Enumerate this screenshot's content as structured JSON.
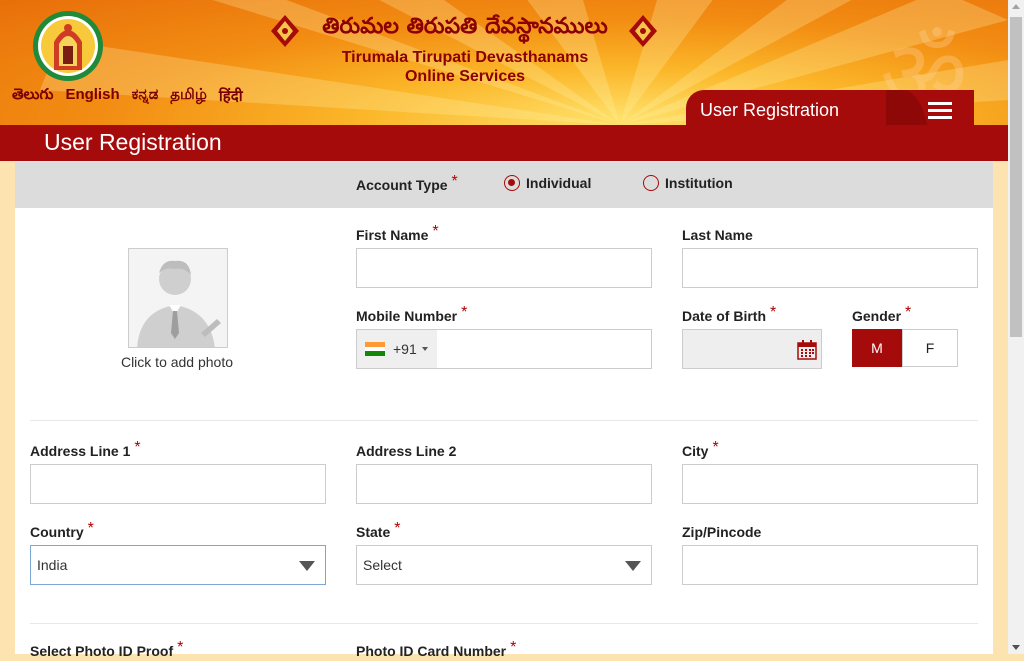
{
  "header": {
    "title_telugu": "తిరుమల తిరుపతి దేవస్థానములు",
    "title_english": "Tirumala Tirupati Devasthanams",
    "subtitle": "Online Services",
    "om_symbol": "ॐ",
    "languages": [
      "తెలుగు",
      "English",
      "ಕನ್ನಡ",
      "தமிழ்",
      "हिंदी"
    ],
    "page_tab_label": "User Registration"
  },
  "page": {
    "title": "User Registration"
  },
  "form": {
    "account_type": {
      "label": "Account Type",
      "required": "*",
      "options": [
        "Individual",
        "Institution"
      ],
      "selected": "Individual"
    },
    "photo_caption": "Click to add photo",
    "first_name": {
      "label": "First Name",
      "required": "*",
      "value": ""
    },
    "last_name": {
      "label": "Last Name",
      "value": ""
    },
    "mobile": {
      "label": "Mobile Number",
      "required": "*",
      "country_code": "+91",
      "value": ""
    },
    "dob": {
      "label": "Date of Birth",
      "required": "*",
      "value": ""
    },
    "gender": {
      "label": "Gender",
      "required": "*",
      "options": [
        "M",
        "F"
      ],
      "selected": "M"
    },
    "address1": {
      "label": "Address Line 1",
      "required": "*",
      "value": ""
    },
    "address2": {
      "label": "Address Line 2",
      "value": ""
    },
    "city": {
      "label": "City",
      "required": "*",
      "value": ""
    },
    "country": {
      "label": "Country",
      "required": "*",
      "value": "India"
    },
    "state": {
      "label": "State",
      "required": "*",
      "value": "Select"
    },
    "zip": {
      "label": "Zip/Pincode",
      "value": ""
    },
    "photo_id_proof": {
      "label": "Select Photo ID Proof",
      "required": "*"
    },
    "photo_id_number": {
      "label": "Photo ID Card Number",
      "required": "*"
    }
  },
  "colors": {
    "brand_red": "#a50b0b",
    "page_bg": "#fde3b0",
    "band_gray": "#dcdcdc",
    "flag_saffron": "#ff9933",
    "flag_green": "#138808"
  }
}
